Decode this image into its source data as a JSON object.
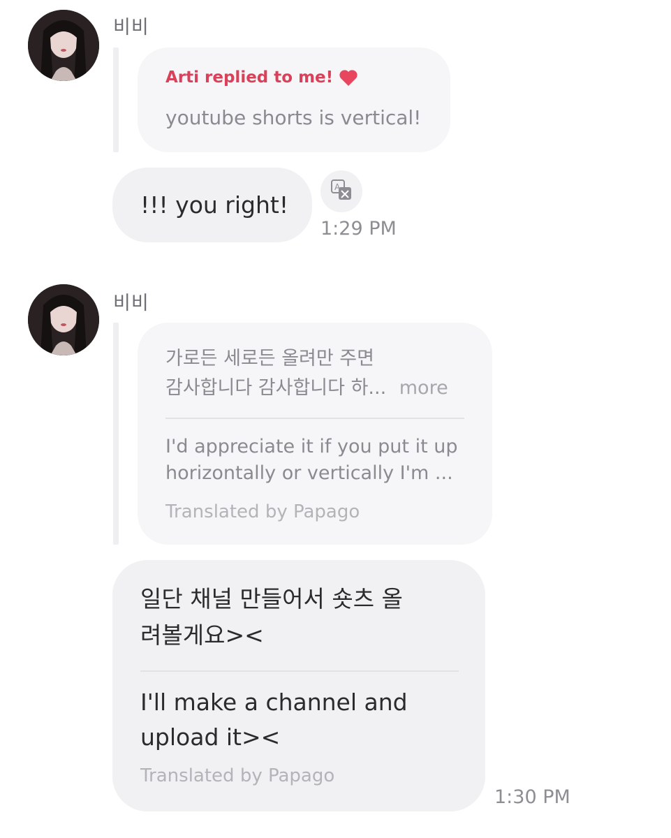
{
  "messages": [
    {
      "sender": "비비",
      "reply": {
        "header": "Arti replied to me!",
        "text": "youtube shorts is vertical!"
      },
      "text": "!!! you right!",
      "time": "1:29 PM"
    },
    {
      "sender": "비비",
      "reply": {
        "original_lines": [
          "가로든 세로든 올려만 주면",
          "감사합니다 감사합니다 하..."
        ],
        "more": "more",
        "translation_lines": [
          "I'd appreciate it if you put it up",
          "horizontally or vertically I'm ..."
        ],
        "translated_by": "Translated by Papago"
      },
      "original_lines": [
        "일단 채널 만들어서 숏츠 올",
        "려볼게요><"
      ],
      "translation_lines": [
        "I'll make a channel and",
        "upload it><"
      ],
      "translated_by": "Translated by Papago",
      "time": "1:30 PM"
    }
  ],
  "colors": {
    "reply_header": "#d9415b",
    "heart": "#e8455f",
    "bubble_bg": "#f1f1f4",
    "quote_bg": "#f6f6f8"
  },
  "icons": {
    "heart": "heart-icon",
    "translate": "translate-icon"
  }
}
